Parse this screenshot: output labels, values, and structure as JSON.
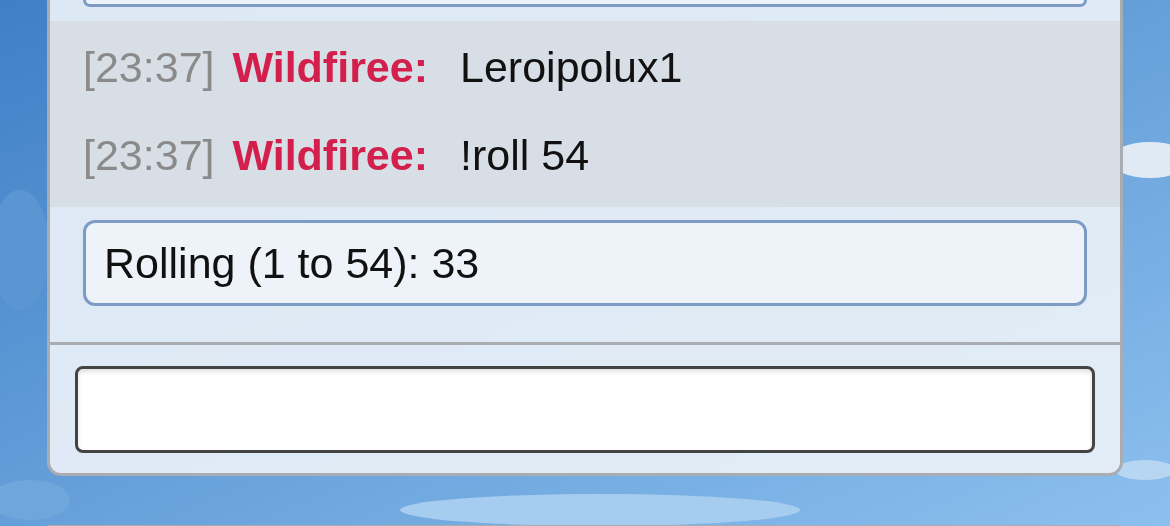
{
  "messages": [
    {
      "time": "[23:37]",
      "author": "Wildfiree:",
      "text": "Leroipolux1"
    },
    {
      "time": "[23:37]",
      "author": "Wildfiree:",
      "text": "!roll 54"
    }
  ],
  "bot_message": {
    "text": "Rolling (1 to 54): 33"
  }
}
